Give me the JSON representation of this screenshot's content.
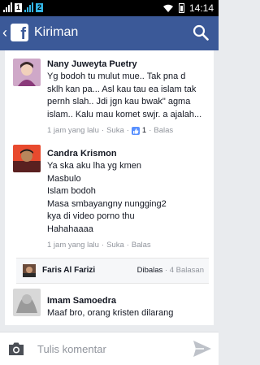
{
  "status_bar": {
    "sim1": "1",
    "sim2": "2",
    "time": "14:14"
  },
  "app_bar": {
    "back_icon": "chevron-left-icon",
    "logo_letter": "f",
    "title": "Kiriman",
    "search_icon": "search-icon"
  },
  "comments": [
    {
      "name": "Nany Juweyta Puetry",
      "text": "Yg bodoh tu mulut mue.. Tak pna d sklh kan pa... Asl kau tau ea islam tak pernh slah.. Jdi jgn kau bwak\" agma islam.. Kalu mau komet swjr. a ajalah...",
      "time": "1 jam yang lalu",
      "sep": "·",
      "like": "Suka",
      "like_count": "1",
      "reply": "Balas"
    },
    {
      "name": "Candra Krismon",
      "lines": [
        "Ya ska aku lha yg kmen",
        "Masbulo",
        "Islam bodoh",
        "Masa smbayangny nungging2 kya di video porno thu",
        "Hahahaaaa"
      ],
      "time": "1 jam yang lalu",
      "sep": "·",
      "like": "Suka",
      "reply": "Balas"
    },
    {
      "name": "Imam Samoedra",
      "text": "Maaf bro, orang kristen dilarang"
    }
  ],
  "reply_summary": {
    "name": "Faris Al Farizi",
    "replied_label": "Dibalas",
    "sep": "·",
    "count_label": "4 Balasan"
  },
  "composer": {
    "camera_icon": "camera-icon",
    "placeholder": "Tulis komentar",
    "send_icon": "send-icon"
  },
  "colors": {
    "brand": "#3b5998",
    "background": "#e9ebee",
    "muted_text": "#90949c"
  }
}
